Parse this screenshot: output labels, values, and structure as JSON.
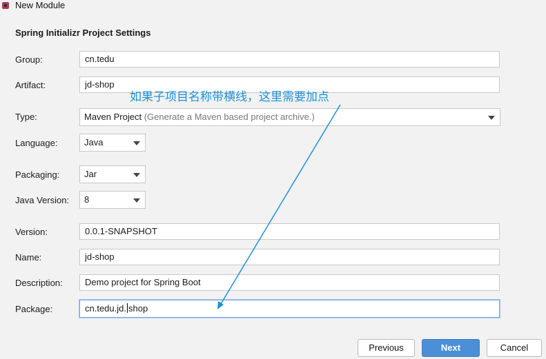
{
  "window": {
    "title": "New Module"
  },
  "section_title": "Spring Initializr Project Settings",
  "fields": {
    "group": {
      "label": "Group:",
      "value": "cn.tedu"
    },
    "artifact": {
      "label": "Artifact:",
      "value": "jd-shop"
    },
    "type": {
      "label": "Type:",
      "value": "Maven Project",
      "hint": "(Generate a Maven based project archive.)"
    },
    "language": {
      "label": "Language:",
      "value": "Java"
    },
    "packaging": {
      "label": "Packaging:",
      "value": "Jar"
    },
    "java_version": {
      "label": "Java Version:",
      "value": "8"
    },
    "version": {
      "label": "Version:",
      "value": "0.0.1-SNAPSHOT"
    },
    "name": {
      "label": "Name:",
      "value": "jd-shop"
    },
    "description": {
      "label": "Description:",
      "value": "Demo project for Spring Boot"
    },
    "package": {
      "label": "Package:",
      "value_before_caret": "cn.tedu.jd.",
      "value_after_caret": "shop"
    }
  },
  "annotation": {
    "text": "如果子项目名称带横线，这里需要加点",
    "color": "#1e90d6"
  },
  "buttons": {
    "previous": "Previous",
    "next": "Next",
    "cancel": "Cancel"
  },
  "colors": {
    "primary_button": "#4b8fd6",
    "background": "#f2f2f2"
  }
}
